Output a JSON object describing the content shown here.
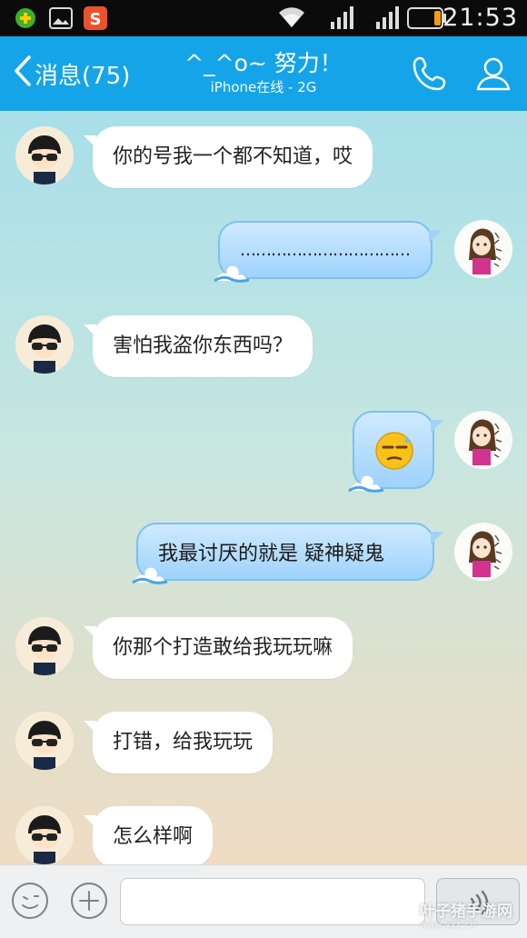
{
  "status_bar": {
    "time": "21:53",
    "icons": [
      "app-add-icon",
      "gallery-icon",
      "sogou-keyboard-icon",
      "wifi-icon",
      "signal-icon",
      "signal-icon",
      "battery-icon"
    ],
    "colors": {
      "app_add": "#3fae32",
      "gallery": "#dcdcdc",
      "sogou": "#e8532b"
    }
  },
  "header": {
    "back_label": "消息(75)",
    "title": "^_^o~ 努力！",
    "subtitle": "iPhone在线 - 2G",
    "call_icon": "phone-icon",
    "profile_icon": "person-icon",
    "color": "#15a4e8"
  },
  "messages": [
    {
      "side": "incoming",
      "text": "你的号我一个都不知道，哎"
    },
    {
      "side": "outgoing",
      "text": "……………………………"
    },
    {
      "side": "incoming",
      "text": "害怕我盗你东西吗？"
    },
    {
      "side": "outgoing",
      "emoji": "sweat-face-emoji",
      "text": ""
    },
    {
      "side": "outgoing",
      "text": "我最讨厌的就是 疑神疑鬼"
    },
    {
      "side": "incoming",
      "text": "你那个打造敢给我玩玩嘛"
    },
    {
      "side": "incoming",
      "text": "打错，给我玩玩"
    },
    {
      "side": "incoming",
      "text": "怎么样啊"
    }
  ],
  "input_bar": {
    "emoji_icon": "smiley-icon",
    "plus_icon": "plus-icon",
    "voice_icon": "voice-wave-icon",
    "placeholder": ""
  },
  "watermark": {
    "text": "叶子猪手游网",
    "url_text": "www.yzz.cn"
  }
}
